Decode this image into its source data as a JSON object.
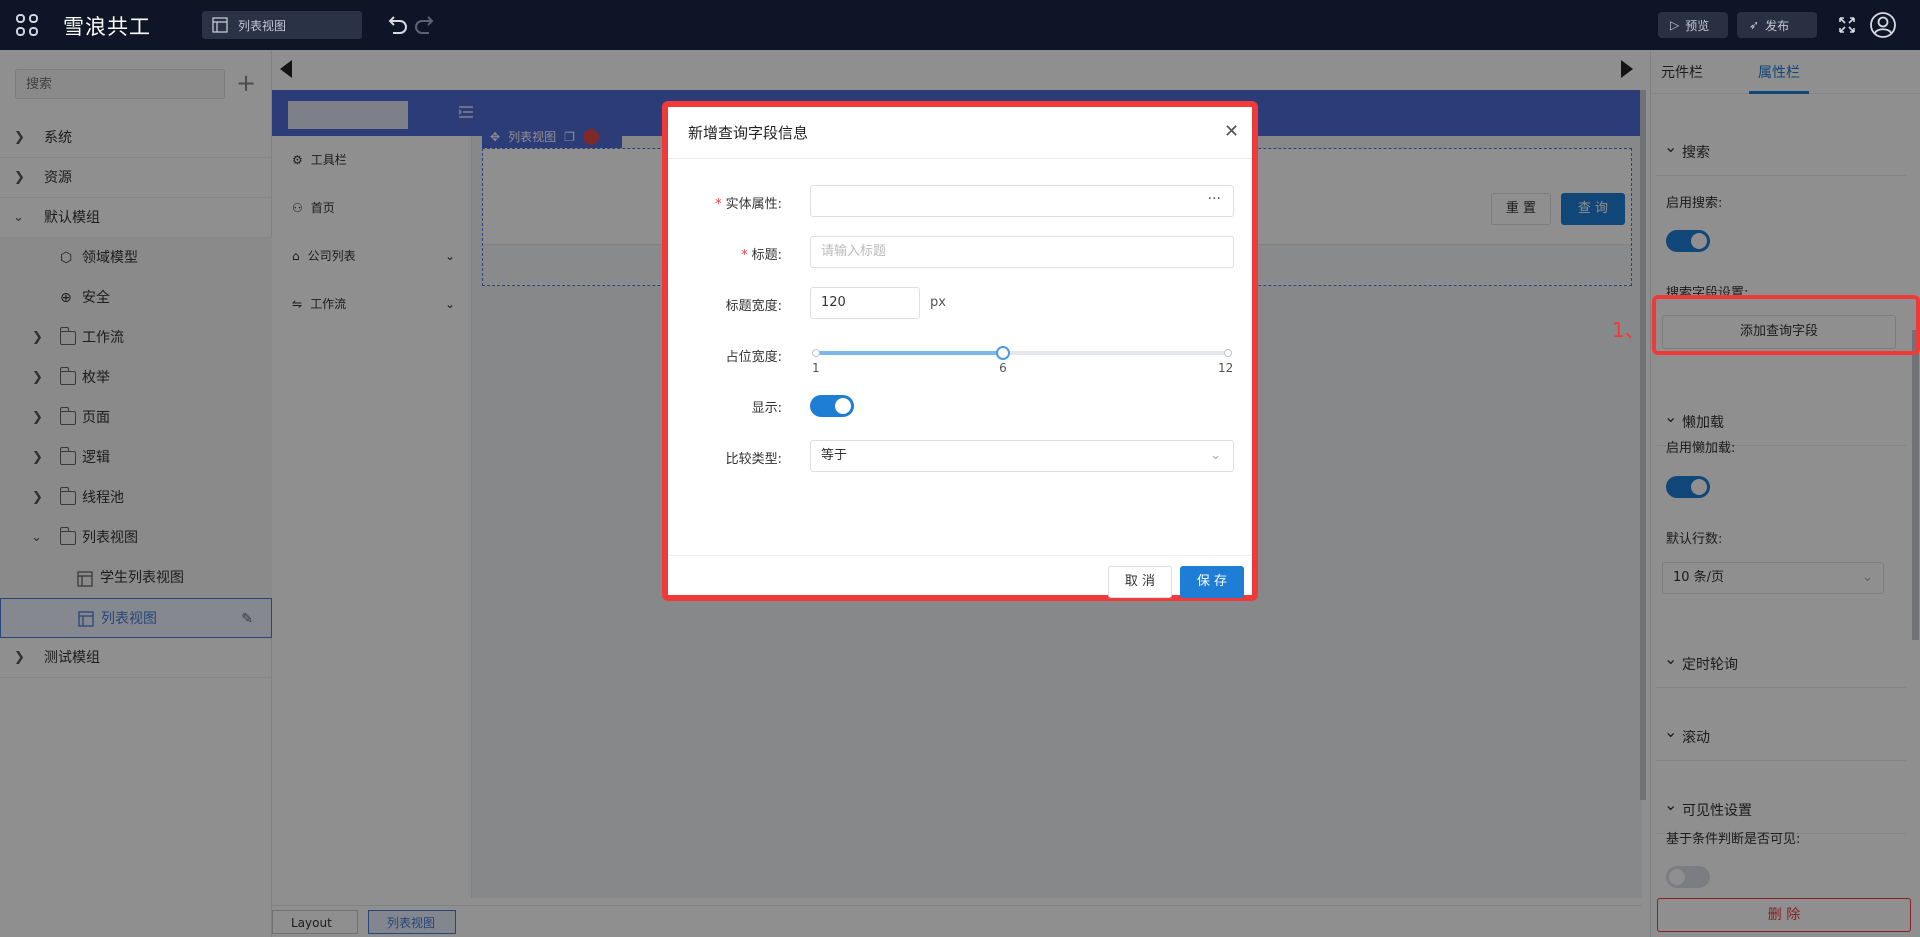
{
  "topbar": {
    "brand": "雪浪共工",
    "doc_tab": "列表视图",
    "preview_label": "预览",
    "publish_label": "发布"
  },
  "sidebar": {
    "search_placeholder": "搜索",
    "items": [
      {
        "label": "系统"
      },
      {
        "label": "资源"
      },
      {
        "label": "默认模组"
      },
      {
        "label": "领域模型"
      },
      {
        "label": "安全"
      },
      {
        "label": "工作流"
      },
      {
        "label": "枚举"
      },
      {
        "label": "页面"
      },
      {
        "label": "逻辑"
      },
      {
        "label": "线程池"
      },
      {
        "label": "列表视图"
      },
      {
        "label": "学生列表视图"
      },
      {
        "label": "列表视图"
      },
      {
        "label": "测试模组"
      }
    ]
  },
  "preview_app": {
    "nav": [
      {
        "label": "工具栏"
      },
      {
        "label": "首页"
      },
      {
        "label": "公司列表"
      },
      {
        "label": "工作流"
      }
    ],
    "widget_label": "列表视图",
    "reset_label": "重 置",
    "query_label": "查 询"
  },
  "breadcrumb": {
    "items": [
      "Layout",
      "列表视图"
    ]
  },
  "rightpanel": {
    "tabs": [
      "元件栏",
      "属性栏"
    ],
    "section_search": "搜索",
    "enable_search_label": "启用搜索:",
    "search_field_settings_label": "搜索字段设置:",
    "add_field_button": "添加查询字段",
    "annotation_number": "1、",
    "section_lazy": "懒加载",
    "enable_lazy_label": "启用懒加载:",
    "default_rows_label": "默认行数:",
    "default_rows_value": "10 条/页",
    "section_poll": "定时轮询",
    "section_scroll": "滚动",
    "section_visibility": "可见性设置",
    "visibility_condition_label": "基于条件判断是否可见:",
    "delete_button": "删 除"
  },
  "dialog": {
    "title": "新增查询字段信息",
    "entity_attr_label": "实体属性:",
    "entity_attr_value": "",
    "title_label": "标题:",
    "title_placeholder": "请输入标题",
    "title_width_label": "标题宽度:",
    "title_width_value": "120",
    "title_width_unit": "px",
    "placeholder_width_label": "占位宽度:",
    "slider": {
      "min": 1,
      "max": 12,
      "value": 6
    },
    "slider_marks": [
      "1",
      "6",
      "12"
    ],
    "display_label": "显示:",
    "display_enabled": true,
    "compare_type_label": "比较类型:",
    "compare_type_value": "等于",
    "cancel_button": "取 消",
    "save_button": "保 存"
  },
  "colors": {
    "accent": "#1e7ed6",
    "highlight": "#f03a3a",
    "header": "#0e1526",
    "preview_header": "#4d6bd6"
  }
}
